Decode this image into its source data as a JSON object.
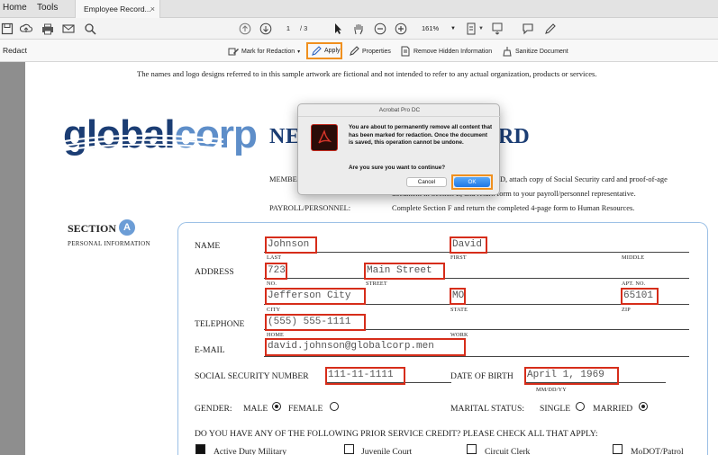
{
  "tabs": {
    "home": "Home",
    "tools": "Tools",
    "document": "Employee Record...",
    "close": "×"
  },
  "toolbar": {
    "page_current": "1",
    "page_total": "/ 3",
    "zoom": "161%"
  },
  "redact": {
    "label": "Redact",
    "mark": "Mark for Redaction",
    "mark_arrow": "▾",
    "apply": "Apply",
    "properties": "Properties",
    "remove_hidden": "Remove Hidden Information",
    "sanitize": "Sanitize Document"
  },
  "doc": {
    "disclaimer": "The names and logo designs referred to in this sample artwork are fictional and not intended to refer to any actual organization, products or services.",
    "logo_part1": "global",
    "logo_part2": "corp",
    "title_left": "NE",
    "title_right": "RD",
    "member_label": "MEMBE",
    "member_text_right": "D, attach copy of Social Security card and proof-of-age",
    "member_text2": "document in Section E, and return form to your payroll/personnel representative.",
    "payroll_label": "PAYROLL/PERSONNEL:",
    "payroll_text": "Complete Section F and return the completed 4-page form to Human Resources.",
    "section_title": "SECTION",
    "section_letter": "A",
    "section_sub": "PERSONAL INFORMATION"
  },
  "form": {
    "name_label": "NAME",
    "address_label": "ADDRESS",
    "telephone_label": "TELEPHONE",
    "email_label": "E-MAIL",
    "ssn_label": "SOCIAL SECURITY NUMBER",
    "dob_label": "DATE OF BIRTH",
    "dob_format": "MM/DD/YY",
    "last_sub": "LAST",
    "first_sub": "FIRST",
    "middle_sub": "MIDDLE",
    "no_sub": "NO.",
    "street_sub": "STREET",
    "apt_sub": "APT. NO.",
    "city_sub": "CITY",
    "state_sub": "STATE",
    "zip_sub": "ZIP",
    "home_sub": "HOME",
    "work_sub": "WORK",
    "last_name": "Johnson",
    "first_name": "David",
    "street_no": "723",
    "street": "Main Street",
    "city": "Jefferson City",
    "state": "MO",
    "zip": "65101",
    "phone": "(555) 555-1111",
    "email": "david.johnson@globalcorp.men",
    "ssn": "111-11-1111",
    "dob": "April 1, 1969",
    "gender_label": "GENDER:",
    "male": "MALE",
    "female": "FEMALE",
    "marital_label": "MARITAL STATUS:",
    "single": "SINGLE",
    "married": "MARRIED",
    "prior_q": "DO YOU HAVE ANY OF THE FOLLOWING PRIOR SERVICE CREDIT? PLEASE CHECK ALL THAT APPLY:",
    "opt1": "Active Duty Military",
    "opt2": "Juvenile Court",
    "opt3": "Circuit Clerk",
    "opt4": "MoDOT/Patrol"
  },
  "dialog": {
    "title": "Acrobat Pro DC",
    "message": "You are about to permanently remove all content that has been marked for redaction. Once the document is saved, this operation cannot be undone.",
    "question": "Are you sure you want to continue?",
    "cancel": "Cancel",
    "ok": "OK"
  },
  "colors": {
    "redaction_box": "#d62d1a",
    "highlight": "#f0901e",
    "brand_dark": "#1b3d74",
    "brand_light": "#5e8ec9"
  }
}
